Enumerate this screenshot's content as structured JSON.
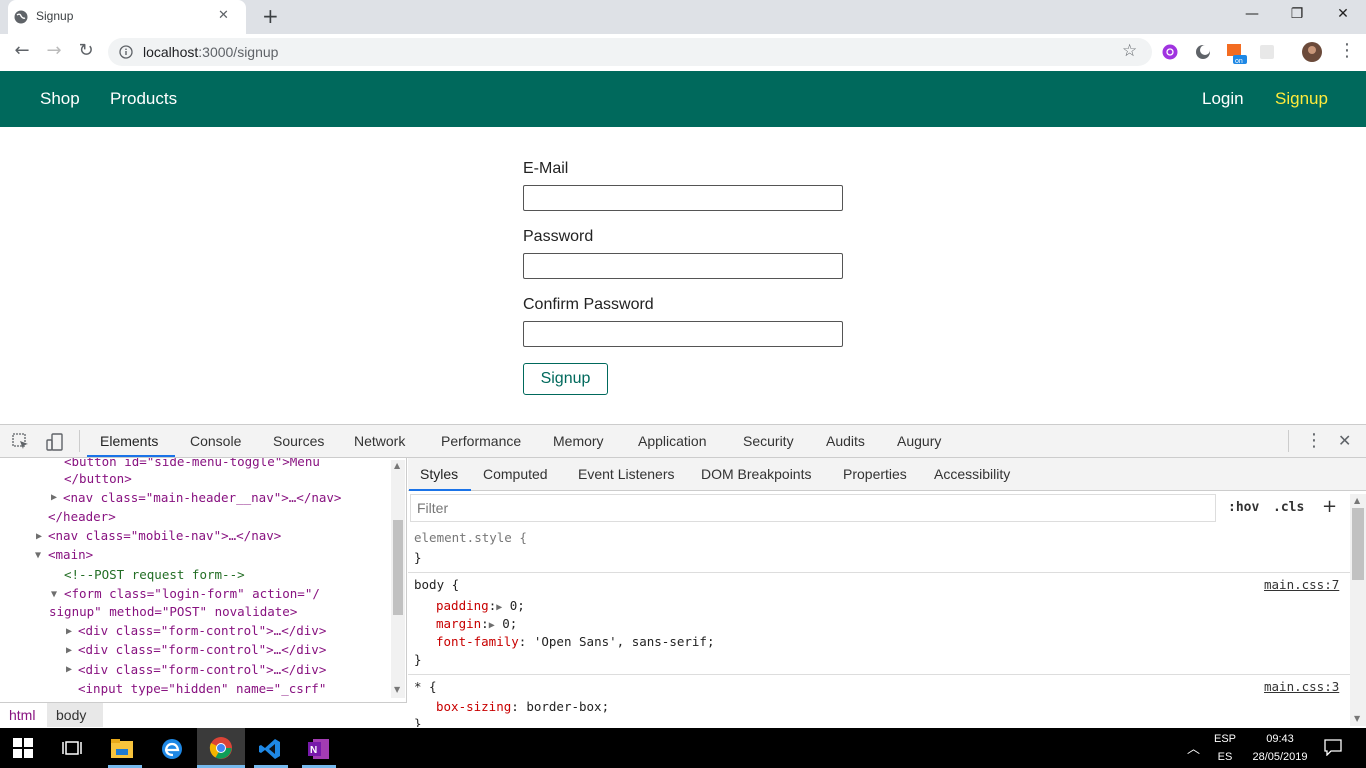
{
  "browser": {
    "tab_title": "Signup",
    "tab_close": "✕",
    "new_tab": "+",
    "window_controls": {
      "minimize": "—",
      "maximize": "❐",
      "close": "✕"
    },
    "url_host": "localhost",
    "url_path": ":3000/signup",
    "toolbar_icons": [
      "back-icon",
      "forward-icon",
      "reload-icon",
      "info-icon",
      "star-icon",
      "extension-icons",
      "profile-avatar",
      "menu-icon"
    ]
  },
  "site": {
    "nav_left": [
      "Shop",
      "Products"
    ],
    "nav_right": [
      "Login",
      "Signup"
    ],
    "header_color": "#00695c",
    "active_color": "#ffeb3b"
  },
  "form": {
    "email_label": "E-Mail",
    "password_label": "Password",
    "confirm_label": "Confirm Password",
    "email_value": "",
    "password_value": "",
    "confirm_value": "",
    "submit_label": "Signup"
  },
  "devtools": {
    "tabs": [
      "Elements",
      "Console",
      "Sources",
      "Network",
      "Performance",
      "Memory",
      "Application",
      "Security",
      "Audits",
      "Augury"
    ],
    "active_tab": "Elements",
    "sub_tabs": [
      "Styles",
      "Computed",
      "Event Listeners",
      "DOM Breakpoints",
      "Properties",
      "Accessibility"
    ],
    "active_sub_tab": "Styles",
    "filter_placeholder": "Filter",
    "hov": ":hov",
    "cls": ".cls",
    "add_rule": "+",
    "breadcrumbs": [
      "html",
      "body"
    ],
    "dom_lines": {
      "l0": "<button id=\"side-menu-toggle\">Menu",
      "l1": "</button>",
      "l2": "<nav class=\"main-header__nav\">…</nav>",
      "l3": "</header>",
      "l4": "<nav class=\"mobile-nav\">…</nav>",
      "l5": "<main>",
      "l6": "<!--POST request form-->",
      "l7": "<form class=\"login-form\" action=\"/",
      "l8": "signup\" method=\"POST\" novalidate>",
      "l9": "<div class=\"form-control\">…</div>",
      "l10": "<div class=\"form-control\">…</div>",
      "l11": "<div class=\"form-control\">…</div>",
      "l12": "<input type=\"hidden\" name=\"_csrf\""
    },
    "styles": {
      "element_style": "element.style {",
      "close_brace": "}",
      "body_selector": "body {",
      "body_source": "main.css:7",
      "padding_prop": "padding",
      "padding_val": "0;",
      "margin_prop": "margin",
      "margin_val": "0;",
      "font_prop": "font-family",
      "font_val": "'Open Sans', sans-serif;",
      "star_selector": "* {",
      "star_source": "main.css:3",
      "box_prop": "box-sizing",
      "box_val": "border-box;"
    }
  },
  "taskbar": {
    "lang_top": "ESP",
    "lang_bottom": "ES",
    "time": "09:43",
    "date": "28/05/2019"
  }
}
